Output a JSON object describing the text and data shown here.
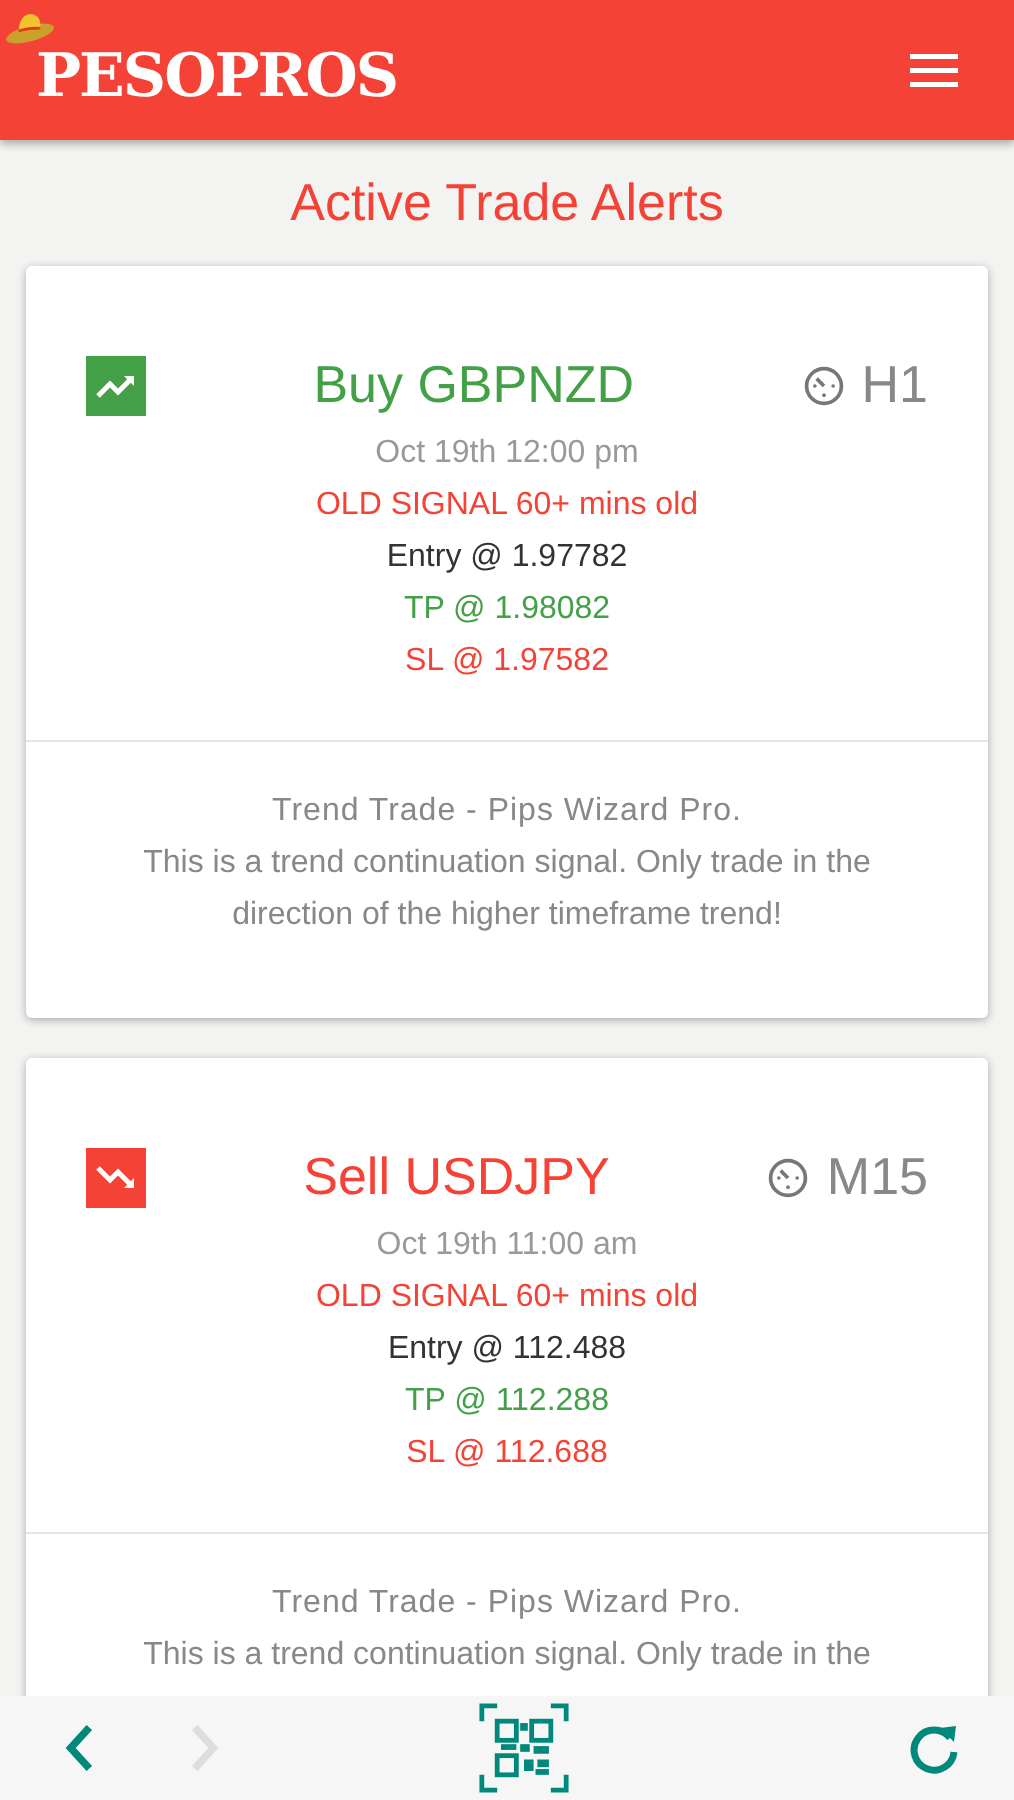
{
  "header": {
    "logo": "PESOPROS"
  },
  "page_title": "Active Trade Alerts",
  "alerts": [
    {
      "kind": "buy",
      "title": "Buy GBPNZD",
      "timeframe": "H1",
      "time": "Oct 19th 12:00 pm",
      "age_warning": "OLD SIGNAL 60+ mins old",
      "entry": "Entry @ 1.97782",
      "tp": "TP @ 1.98082",
      "sl": "SL @ 1.97582",
      "strategy": "Trend Trade - Pips Wizard Pro.",
      "description": "This is a trend continuation signal. Only trade in the direction of the higher timeframe trend!"
    },
    {
      "kind": "sell",
      "title": "Sell USDJPY",
      "timeframe": "M15",
      "time": "Oct 19th 11:00 am",
      "age_warning": "OLD SIGNAL 60+ mins old",
      "entry": "Entry @ 112.488",
      "tp": "TP @ 112.288",
      "sl": "SL @ 112.688",
      "strategy": "Trend Trade - Pips Wizard Pro.",
      "description": "This is a trend continuation signal. Only trade in the"
    }
  ],
  "bottom_bar": {
    "back_disabled": false,
    "forward_disabled": true
  }
}
